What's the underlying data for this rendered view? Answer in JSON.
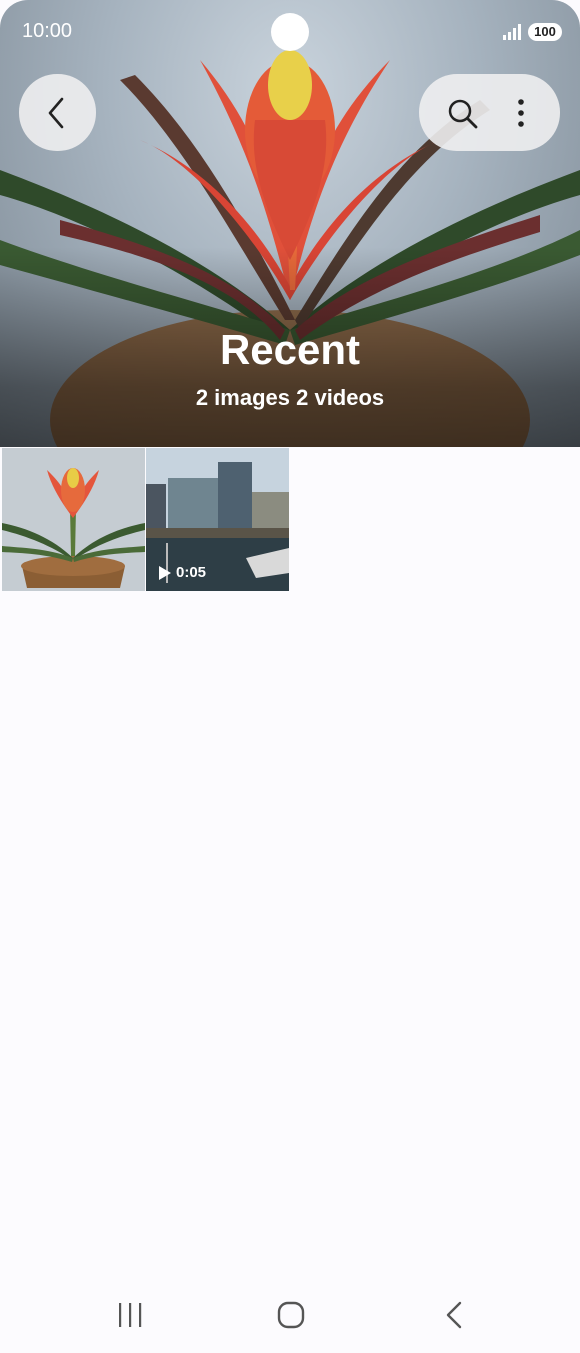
{
  "status_bar": {
    "time": "10:00",
    "battery": "100"
  },
  "album": {
    "title": "Recent",
    "summary": "2 images 2 videos"
  },
  "items": [
    {
      "type": "image",
      "subject": "flowering plant in basket"
    },
    {
      "type": "video",
      "subject": "harbor with buildings",
      "duration": "0:05"
    }
  ],
  "icons": {
    "back": "chevron-left-icon",
    "search": "search-icon",
    "more": "more-vert-icon",
    "nav_recents": "recents-icon",
    "nav_home": "home-icon",
    "nav_back": "back-icon"
  }
}
